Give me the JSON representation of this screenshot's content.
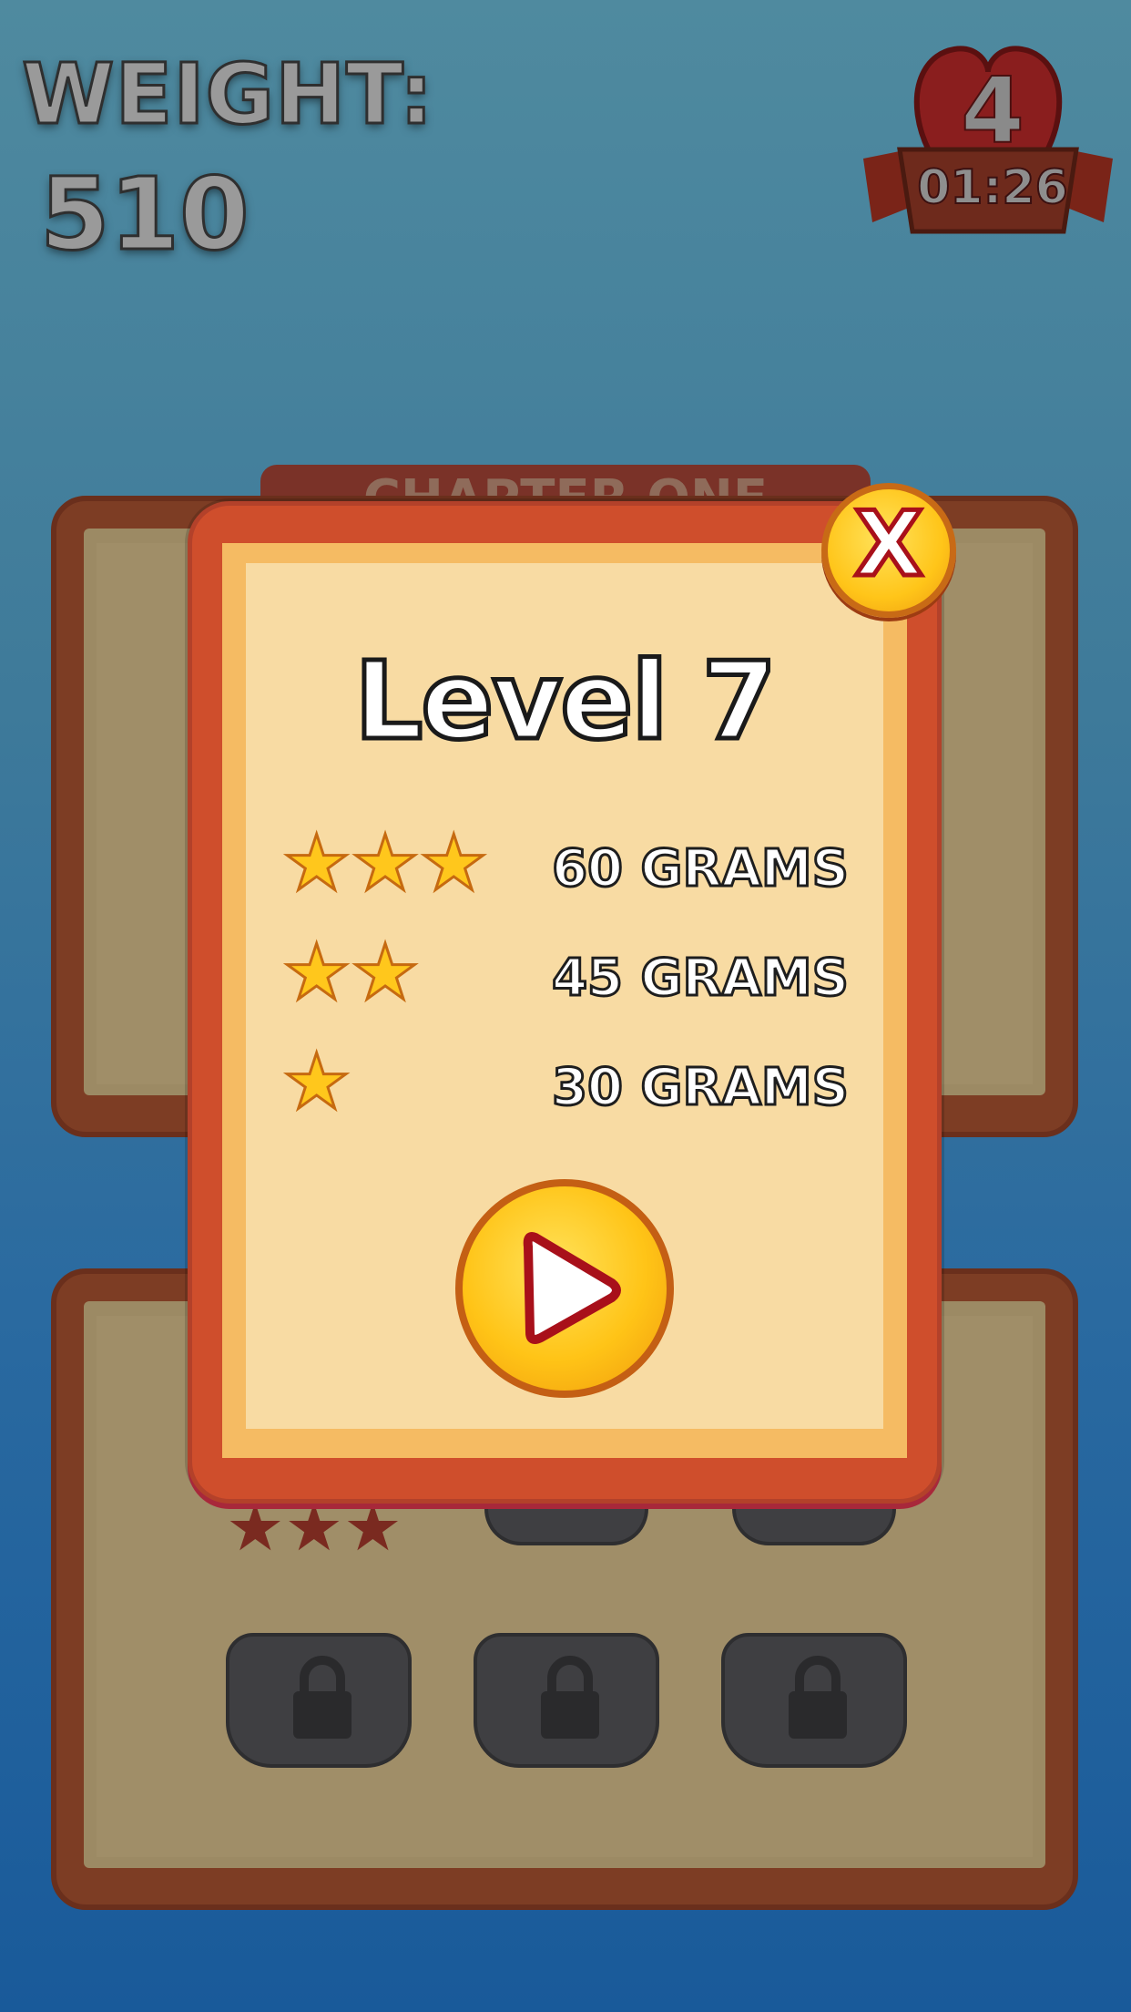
{
  "hud": {
    "weight_label": "WEIGHT:",
    "weight_value": "510",
    "lives_count": "4",
    "lives_timer": "01:26"
  },
  "background": {
    "chapter_ribbon": "CHAPTER ONE"
  },
  "modal": {
    "title": "Level 7",
    "requirements": [
      {
        "stars": 3,
        "label": "60 GRAMS"
      },
      {
        "stars": 2,
        "label": "45 GRAMS"
      },
      {
        "stars": 1,
        "label": "30 GRAMS"
      }
    ],
    "close_label": "X"
  },
  "colors": {
    "modal_frame": "#cf4e2c",
    "paper": "#f8dba3",
    "button_yellow": "#ffc417",
    "star": "#ffc71c"
  },
  "icons": [
    "heart-icon",
    "star-icon",
    "play-icon",
    "close-icon",
    "lock-icon"
  ]
}
